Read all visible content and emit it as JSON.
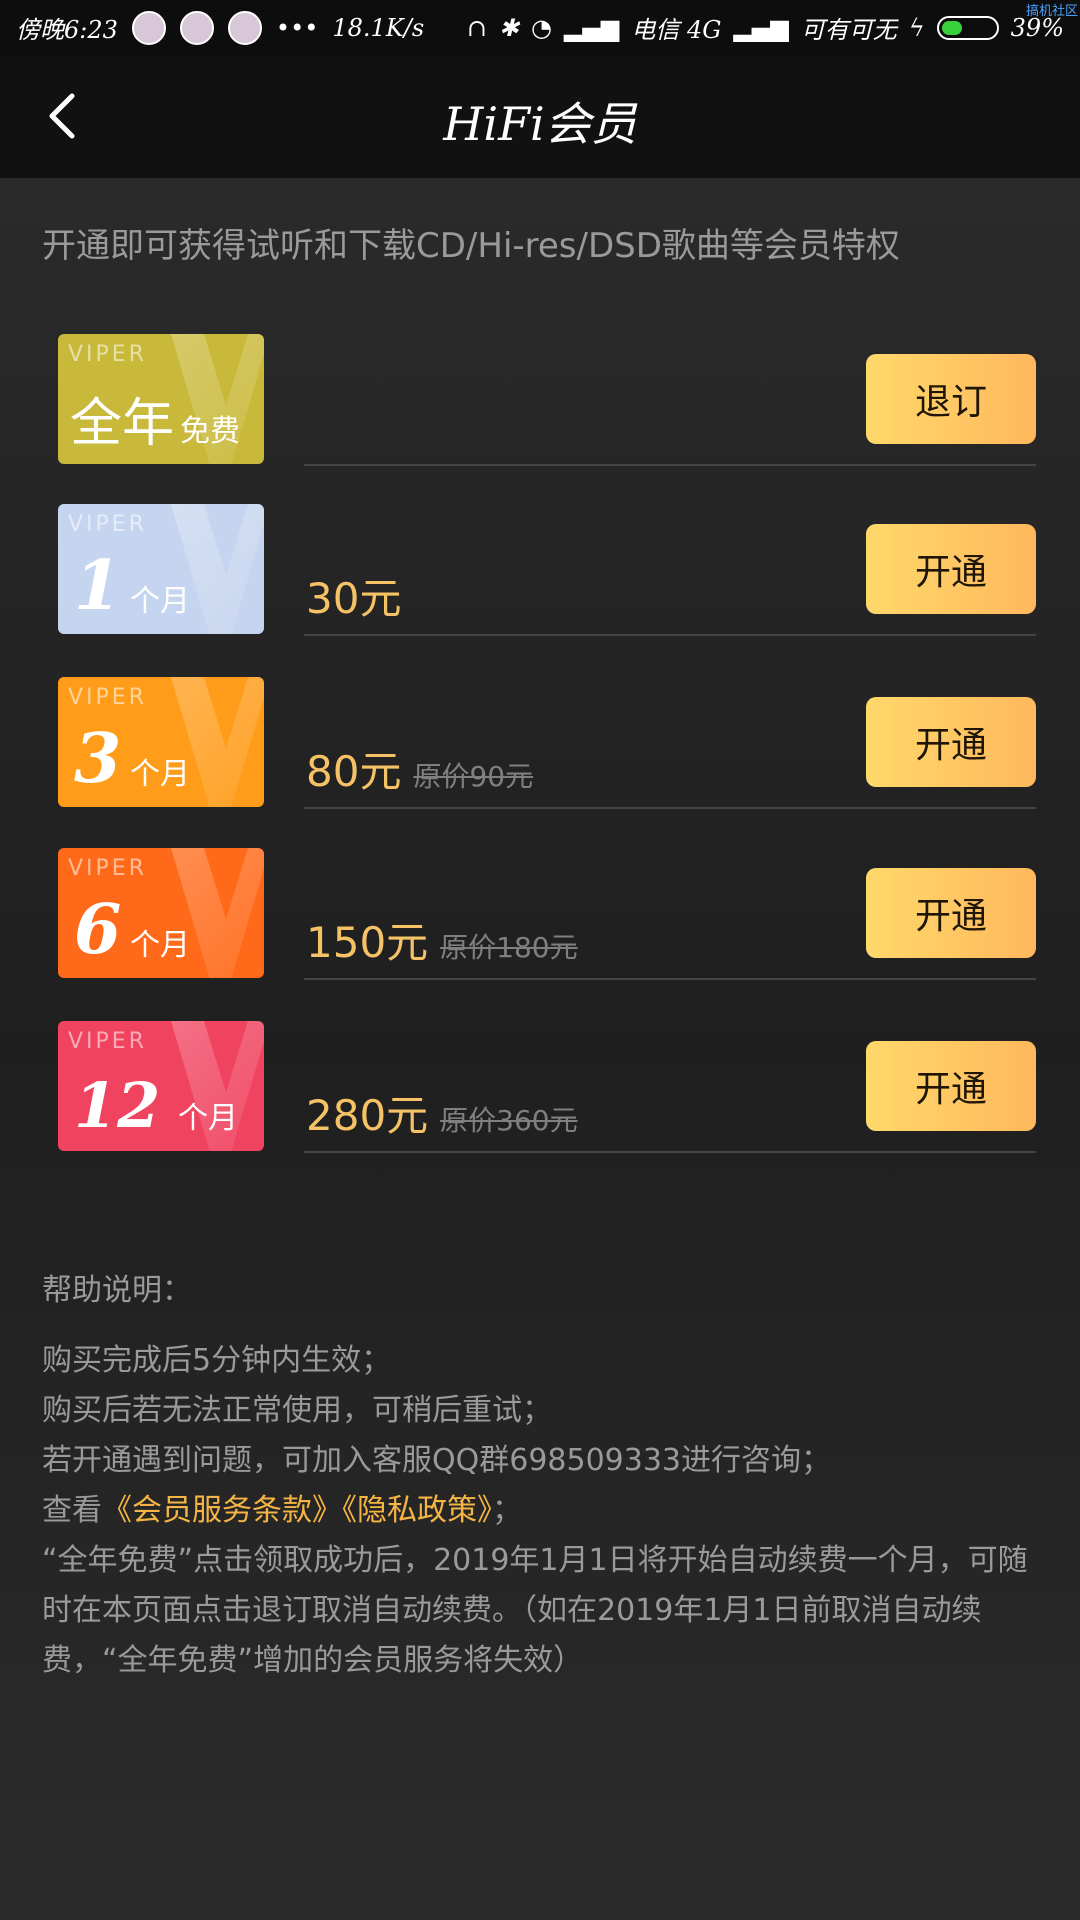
{
  "status": {
    "time": "傍晚6:23",
    "speed": "18.1K/s",
    "carrier": "电信 4G",
    "note": "可有可无",
    "battery": "39%",
    "battery_level": 0.39,
    "watermark": "搞机社区"
  },
  "navbar": {
    "title": "HiFi会员",
    "back_icon": "back-chevron-icon"
  },
  "intro": "开通即可获得试听和下载CD/Hi-res/DSD歌曲等会员特权",
  "plans": [
    {
      "brand": "VIPER",
      "big": "全年",
      "small": "免费",
      "price": "",
      "original": "",
      "button": "退订",
      "color": "#c9b93a"
    },
    {
      "brand": "VIPER",
      "num": "1",
      "unit": "个月",
      "price": "30元",
      "original": "",
      "button": "开通",
      "color": "#c6d5ef"
    },
    {
      "brand": "VIPER",
      "num": "3",
      "unit": "个月",
      "price": "80元",
      "original": "原价90元",
      "button": "开通",
      "color": "#ff9c1a"
    },
    {
      "brand": "VIPER",
      "num": "6",
      "unit": "个月",
      "price": "150元",
      "original": "原价180元",
      "button": "开通",
      "color": "#ff6a1a"
    },
    {
      "brand": "VIPER",
      "num": "12",
      "unit": "个月",
      "price": "280元",
      "original": "原价360元",
      "button": "开通",
      "color": "#f0435f"
    }
  ],
  "help": {
    "head": "帮助说明：",
    "lines": [
      "购买完成后5分钟内生效；",
      "购买后若无法正常使用，可稍后重试；",
      "若开通遇到问题，可加入客服QQ群698509333进行咨询；"
    ],
    "terms_prefix": "查看",
    "terms_link": "《会员服务条款》",
    "privacy_link": "《隐私政策》",
    "terms_suffix": "；",
    "notice": "“全年免费”点击领取成功后，2019年1月1日将开始自动续费一个月，可随时在本页面点击退订取消自动续费。（如在2019年1月1日前取消自动续费，“全年免费”增加的会员服务将失效）"
  }
}
